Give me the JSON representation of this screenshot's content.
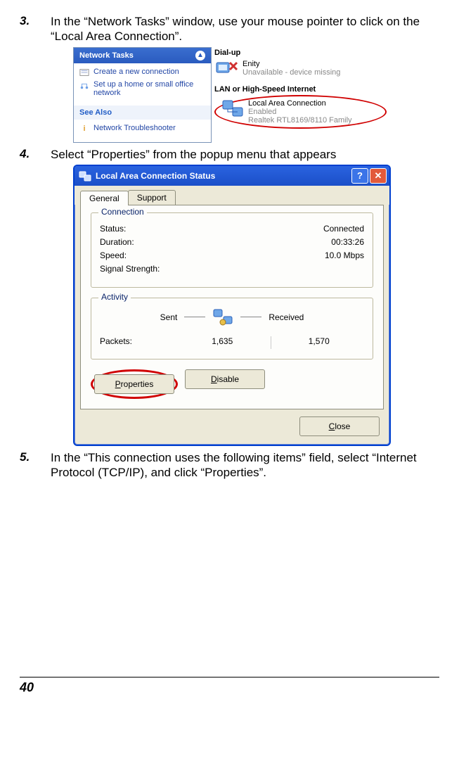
{
  "steps": {
    "s3": {
      "num": "3.",
      "text": "In the “Network Tasks” window, use your mouse pointer to click on the “Local Area Connection”."
    },
    "s4": {
      "num": "4.",
      "text": "Select “Properties” from the popup menu that appears"
    },
    "s5": {
      "num": "5.",
      "text": "In the “This connection uses the following items” field, select “Internet Protocol (TCP/IP), and click “Properties”."
    }
  },
  "fig1": {
    "left": {
      "header": "Network Tasks",
      "items": [
        "Create a new connection",
        "Set up a home or small office network"
      ],
      "see_also": "See Also",
      "troubleshoot": "Network Troubleshooter"
    },
    "right": {
      "cat1": "Dial-up",
      "dialup": {
        "name": "Enity",
        "status": "Unavailable - device missing"
      },
      "cat2": "LAN or High-Speed Internet",
      "lan": {
        "name": "Local Area Connection",
        "status": "Enabled",
        "device": "Realtek RTL8169/8110 Family"
      }
    }
  },
  "fig2": {
    "title": "Local Area Connection Status",
    "tabs": {
      "general": "General",
      "support": "Support"
    },
    "conn_group": "Connection",
    "status_lab": "Status:",
    "status_val": "Connected",
    "duration_lab": "Duration:",
    "duration_val": "00:33:26",
    "speed_lab": "Speed:",
    "speed_val": "10.0 Mbps",
    "signal_lab": "Signal Strength:",
    "act_group": "Activity",
    "sent": "Sent",
    "received": "Received",
    "packets_lab": "Packets:",
    "packets_sent": "1,635",
    "packets_recv": "1,570",
    "btn_properties": "Properties",
    "btn_properties_u": "P",
    "btn_disable": "Disable",
    "btn_disable_u": "D",
    "btn_close": "Close",
    "btn_close_u": "C"
  },
  "page_number": "40"
}
